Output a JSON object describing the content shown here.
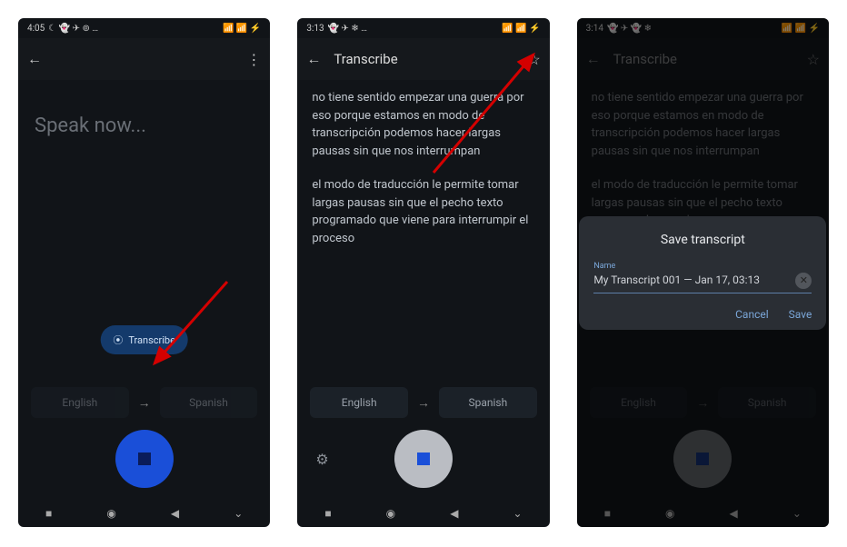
{
  "screens": {
    "s1": {
      "time": "4:05",
      "status_icons": "☾ 👻 ✈ ⊚ …",
      "status_right": "📶 📶 ⚡",
      "title": "",
      "speak": "Speak now...",
      "pill": "Transcribe",
      "lang_from": "English",
      "lang_to": "Spanish"
    },
    "s2": {
      "time": "3:13",
      "status_icons": "👻 ✈ ❄ …",
      "status_right": "📶 📶 ⚡",
      "title": "Transcribe",
      "para1": "no tiene sentido empezar una guerra por eso porque estamos en modo de transcripción podemos hacer largas pausas sin que nos interrumpan",
      "para2": "el modo de traducción le permite tomar largas pausas sin que el pecho texto programado que viene para interrumpir el proceso",
      "lang_from": "English",
      "lang_to": "Spanish"
    },
    "s3": {
      "time": "3:14",
      "status_icons": "👻 ✈ 👻 ❄",
      "status_right": "📶 📶 ⚡",
      "title": "Transcribe",
      "para1": "no tiene sentido empezar una guerra por eso porque estamos en modo de transcripción podemos hacer largas pausas sin que nos interrumpan",
      "para2": "el modo de traducción le permite tomar largas pausas sin que el pecho texto programado que viene",
      "lang_from": "English",
      "lang_to": "Spanish",
      "dialog": {
        "title": "Save transcript",
        "name_label": "Name",
        "name_value": "My Transcript 001 — Jan 17, 03:13",
        "cancel": "Cancel",
        "save": "Save"
      }
    }
  }
}
